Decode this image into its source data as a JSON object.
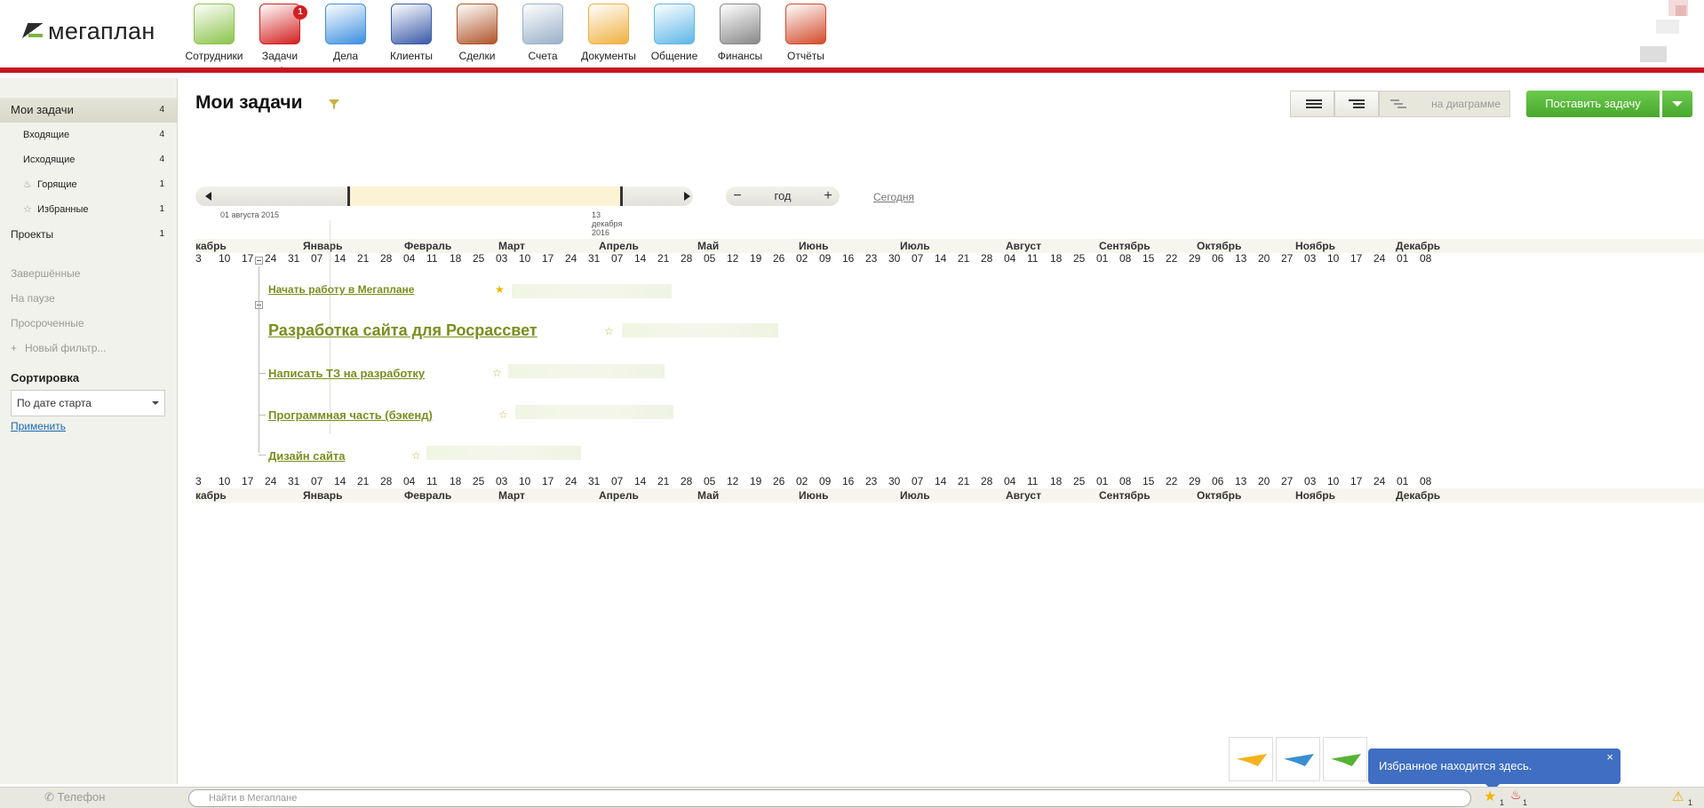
{
  "app": {
    "logo_text": "мегаплан"
  },
  "nav": [
    {
      "label": "Сотрудники",
      "icon": "employees-icon",
      "color": "#8bc34a"
    },
    {
      "label": "Задачи",
      "icon": "tasks-icon",
      "color": "#d21f1f",
      "badge": "1",
      "active": true
    },
    {
      "label": "Дела",
      "icon": "clock-icon",
      "color": "#3d8fe0"
    },
    {
      "label": "Клиенты",
      "icon": "address-book-icon",
      "color": "#3a5aa8"
    },
    {
      "label": "Сделки",
      "icon": "briefcase-icon",
      "color": "#b0552a"
    },
    {
      "label": "Счета",
      "icon": "invoice-icon",
      "color": "#9ab0c8"
    },
    {
      "label": "Документы",
      "icon": "folder-icon",
      "color": "#f0b040"
    },
    {
      "label": "Общение",
      "icon": "chat-bubbles-icon",
      "color": "#5db7e8"
    },
    {
      "label": "Финансы",
      "icon": "safe-icon",
      "color": "#888888"
    },
    {
      "label": "Отчёты",
      "icon": "report-chart-icon",
      "color": "#d24a2a"
    }
  ],
  "sidebar": {
    "items": [
      {
        "label": "Мои задачи",
        "count": "4"
      },
      {
        "label": "Входящие",
        "count": "4"
      },
      {
        "label": "Исходящие",
        "count": "4"
      },
      {
        "label": "Горящие",
        "count": "1"
      },
      {
        "label": "Избранные",
        "count": "1"
      },
      {
        "label": "Проекты",
        "count": "1"
      },
      {
        "label": "Завершённые"
      },
      {
        "label": "На паузе"
      },
      {
        "label": "Просроченные"
      },
      {
        "label": "Новый фильтр..."
      }
    ],
    "sort_title": "Сортировка",
    "sort_value": "По дате старта",
    "apply": "Применить"
  },
  "main": {
    "title": "Мои задачи",
    "view_diagram": "на диаграмме",
    "add_task": "Поставить задачу",
    "timeline_start": "01 августа 2015",
    "timeline_end": "13 декабря 2016",
    "zoom_level": "год",
    "today": "Сегодня"
  },
  "months": [
    "кабрь",
    "Январь",
    "Февраль",
    "Март",
    "Апрель",
    "Май",
    "Июнь",
    "Июль",
    "Август",
    "Сентябрь",
    "Октябрь",
    "Ноябрь",
    "Декабрь"
  ],
  "days": [
    "3",
    "10",
    "17",
    "24",
    "31",
    "07",
    "14",
    "21",
    "28",
    "04",
    "11",
    "18",
    "25",
    "03",
    "10",
    "17",
    "24",
    "31",
    "07",
    "14",
    "21",
    "28",
    "05",
    "12",
    "19",
    "26",
    "02",
    "09",
    "16",
    "23",
    "30",
    "07",
    "14",
    "21",
    "28",
    "04",
    "11",
    "18",
    "25",
    "01",
    "08",
    "15",
    "22",
    "29",
    "06",
    "13",
    "20",
    "27",
    "03",
    "10",
    "17",
    "24",
    "01",
    "08"
  ],
  "tasks": [
    {
      "label": "Начать работу в Мегаплане",
      "starred": true
    },
    {
      "label": "Разработка сайта для Росрассвет",
      "starred": false
    },
    {
      "label": "Написать ТЗ на разработку",
      "starred": false
    },
    {
      "label": "Программная часть (бэкенд)",
      "starred": false
    },
    {
      "label": "Дизайн сайта",
      "starred": false
    }
  ],
  "bottom": {
    "phone": "Телефон",
    "search_placeholder": "Найти в Мегаплане",
    "star_count": "1",
    "fire_count": "1",
    "warn_count": "1"
  },
  "toast": {
    "text": "Избранное находится здесь.",
    "close": "×"
  },
  "colors": {
    "accent_red": "#c8141e",
    "task_green": "#7a8e1d",
    "button_green": "#55b336",
    "toast_blue": "#3f6ec2"
  }
}
